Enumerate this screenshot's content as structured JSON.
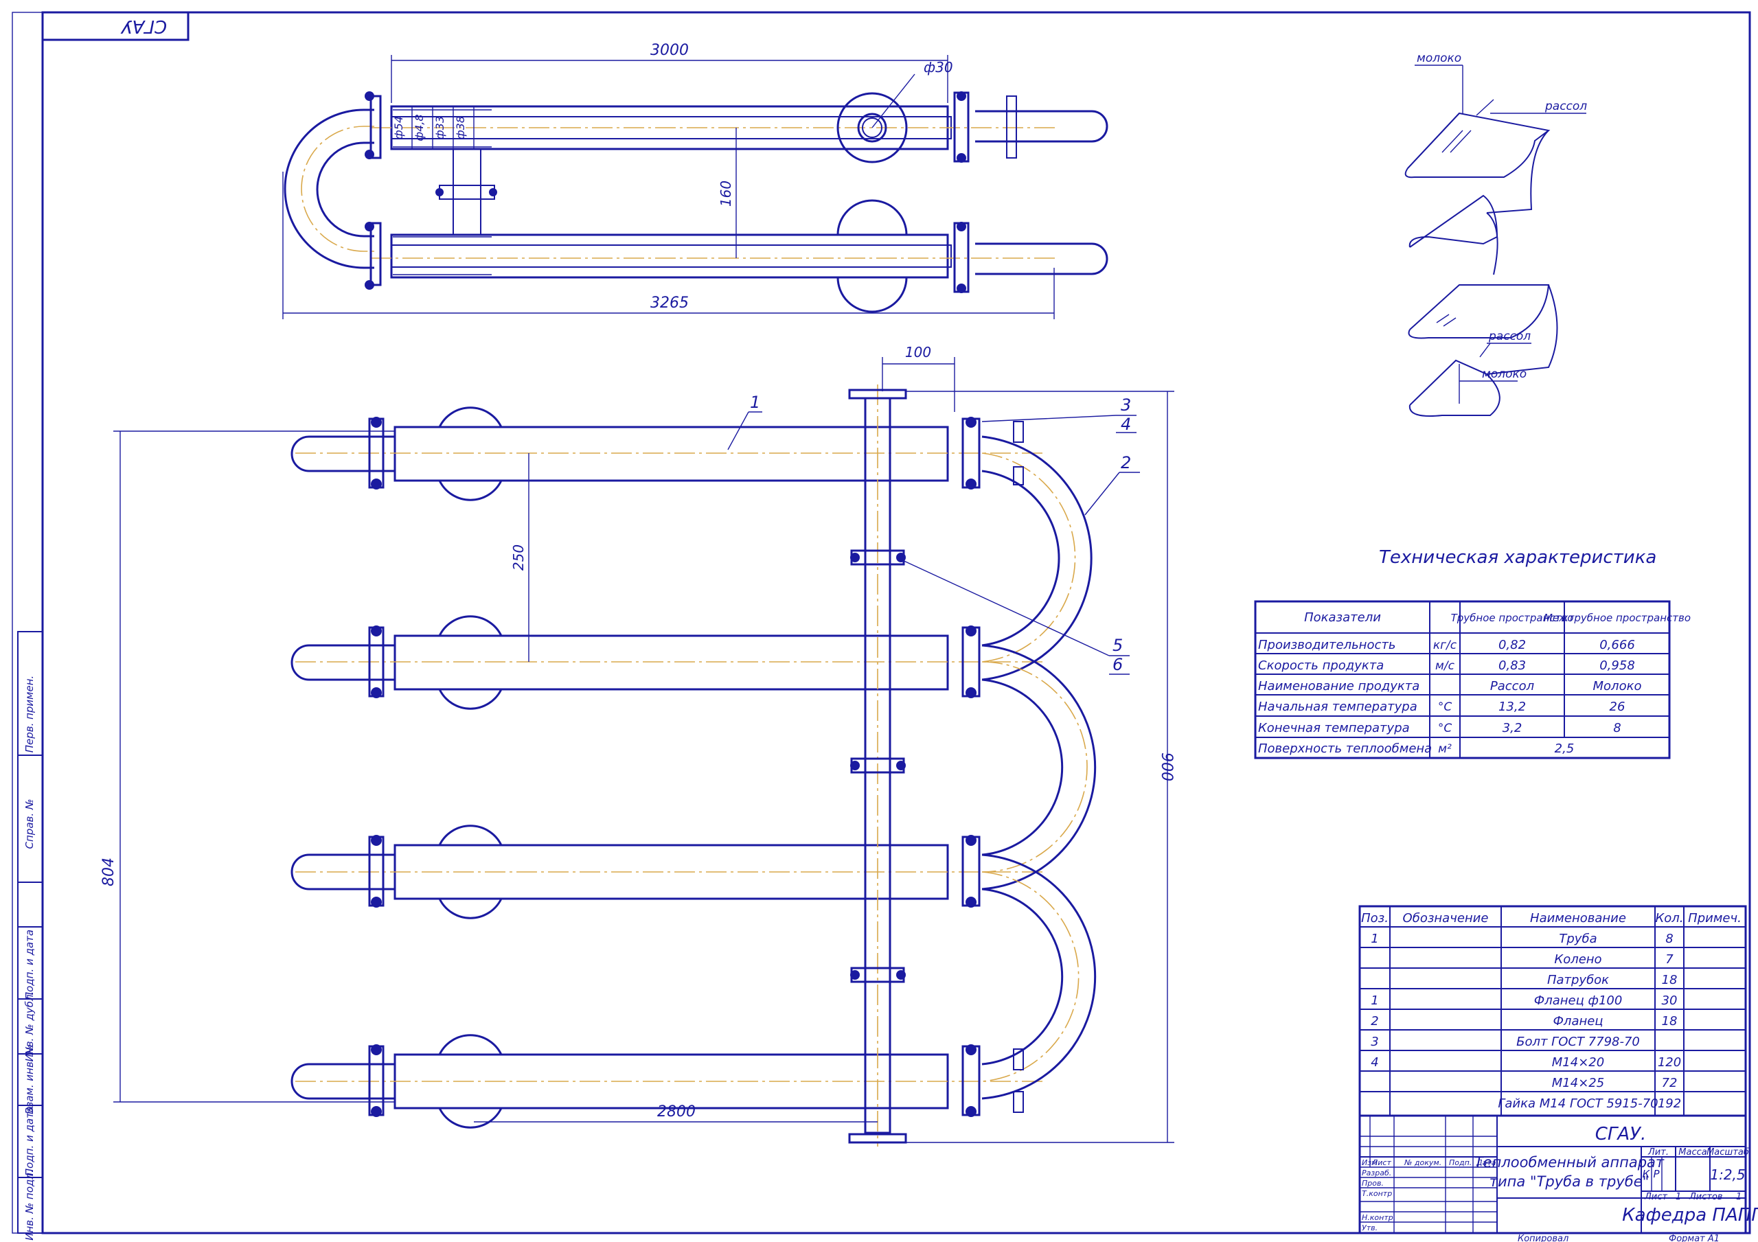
{
  "stamp": "СГАУ",
  "colors": {
    "line": "#1a1aa0",
    "axis": "#d9a84a"
  },
  "top_view": {
    "dims": {
      "length": "3000",
      "overall": "3265",
      "pitch": "160",
      "port": "ф30",
      "d1": "ф54",
      "d2": "ф4,8",
      "d3": "ф33",
      "d4": "ф38"
    }
  },
  "front_view": {
    "dims": {
      "flange": "100",
      "spacing": "250",
      "height_left": "804",
      "height_right": "900",
      "bottom": "2800"
    },
    "callouts": [
      "1",
      "2",
      "3",
      "4",
      "5",
      "6"
    ]
  },
  "flow_scheme": {
    "milk": "молоко",
    "brine": "рассол"
  },
  "spec": {
    "title": "Техническая характеристика",
    "headers": [
      "Показатели",
      "",
      "Трубное пространство",
      "Межтрубное пространство"
    ],
    "rows": [
      [
        "Производительность",
        "кг/с",
        "0,82",
        "0,666"
      ],
      [
        "Скорость продукта",
        "м/с",
        "0,83",
        "0,958"
      ],
      [
        "Наименование продукта",
        "",
        "Рассол",
        "Молоко"
      ],
      [
        "Начальная температура",
        "°С",
        "13,2",
        "26"
      ],
      [
        "Конечная температура",
        "°С",
        "3,2",
        "8"
      ],
      [
        "Поверхность теплообмена",
        "м²",
        "2,5",
        ""
      ]
    ]
  },
  "bom": {
    "headers": [
      "Поз.",
      "Обозначение",
      "Наименование",
      "Кол.",
      "Примеч."
    ],
    "rows": [
      [
        "1",
        "",
        "Труба",
        "8",
        ""
      ],
      [
        "",
        "",
        "Колено",
        "7",
        ""
      ],
      [
        "",
        "",
        "Патрубок",
        "18",
        ""
      ],
      [
        "1",
        "",
        "Фланец ф100",
        "30",
        ""
      ],
      [
        "2",
        "",
        "Фланец",
        "18",
        ""
      ],
      [
        "3",
        "",
        "Болт ГОСТ 7798-70",
        "",
        ""
      ],
      [
        "4",
        "",
        "М14×20",
        "120",
        ""
      ],
      [
        "",
        "",
        "М14×25",
        "72",
        ""
      ],
      [
        "",
        "",
        "Гайка М14 ГОСТ 5915-70",
        "192",
        ""
      ]
    ]
  },
  "title_block": {
    "org": "СГАУ.",
    "name1": "Теплообменный аппарат",
    "name2": "типа \"Труба в трубе\"",
    "lit_h": "Лит.",
    "mass_h": "Масса",
    "scale_h": "Масштаб",
    "lit1": "К",
    "lit2": "Р",
    "scale": "1:2,5",
    "sheet_lbl": "Лист",
    "sheet_no": "1",
    "sheets_lbl": "Листов",
    "sheets_no": "1",
    "dept": "Кафедра ПАПП",
    "cols": [
      "Изм",
      "Лист",
      "№ докум.",
      "Подп.",
      "Дата"
    ],
    "roles": [
      "Разраб.",
      "Пров.",
      "Т.контр",
      "Н.контр.",
      "Утв."
    ],
    "copied": "Копировал",
    "format": "Формат  А1"
  },
  "side_strip": [
    "Перв. примен.",
    "Справ. №",
    "Подп. и дата",
    "Инв. № дубл.",
    "Взам. инв. №",
    "Подп. и дата",
    "Инв. № подл."
  ]
}
